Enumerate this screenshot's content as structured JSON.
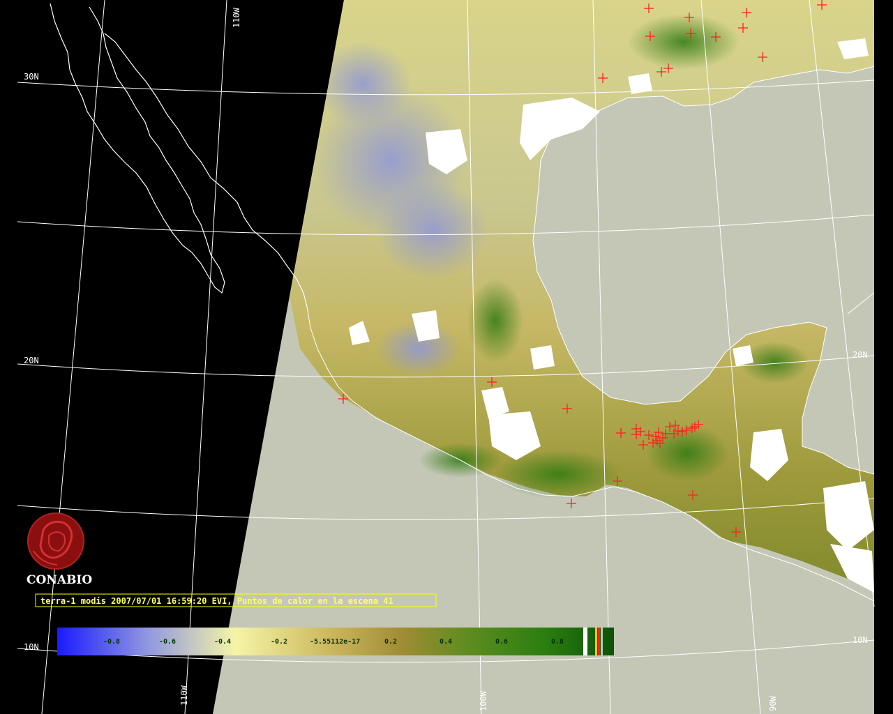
{
  "caption": "terra-1 modis 2007/07/01 16:59:20 EVI, Puntos de calor en la escena 41",
  "brand": {
    "name": "CONABIO",
    "logo_icon": "conabio-logo-icon"
  },
  "graticule": {
    "lat_labels": [
      "30N",
      "20N",
      "20N",
      "10N",
      "10N"
    ],
    "lon_labels": [
      "110W",
      "110W",
      "100W",
      "90W"
    ]
  },
  "colors": {
    "space": "#000000",
    "sea": "#c5c7b6",
    "grid": "#ffffff",
    "coast": "#ffffff",
    "cloud": "#ffffff",
    "hotspot": "#ff2020",
    "caption": "#ffff66"
  },
  "legend": {
    "ticks": [
      "-0.8",
      "-0.6",
      "-0.4",
      "-0.2",
      "-5.55112e-17",
      "0.2",
      "0.4",
      "0.6",
      "0.8"
    ],
    "stops": [
      "#1a1aff",
      "#8f96e0",
      "#f5f5a6",
      "#c9b45a",
      "#a08c35",
      "#5d8c1f",
      "#2a7d10",
      "#0d5208"
    ]
  },
  "hotspot_count": 41
}
